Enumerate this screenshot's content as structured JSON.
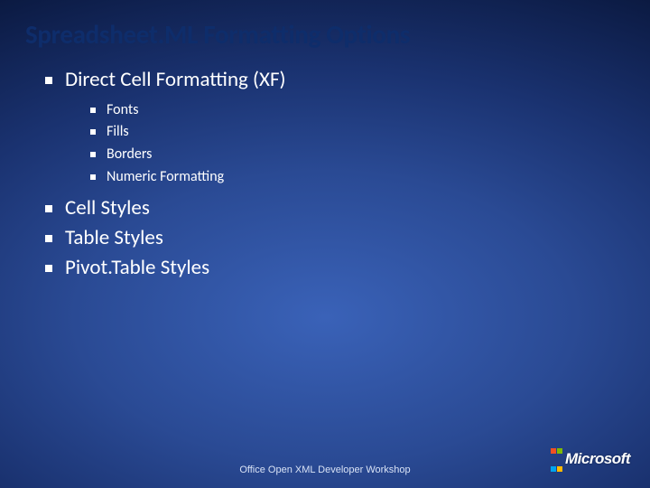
{
  "title": "Spreadsheet.ML Formatting Options",
  "bullets": {
    "item0": "Direct Cell Formatting (XF)",
    "sub": {
      "s0": "Fonts",
      "s1": "Fills",
      "s2": "Borders",
      "s3": "Numeric Formatting"
    },
    "item1": "Cell Styles",
    "item2": "Table Styles",
    "item3": "Pivot.Table Styles"
  },
  "footer": "Office Open XML Developer Workshop",
  "logo": "Microsoft"
}
